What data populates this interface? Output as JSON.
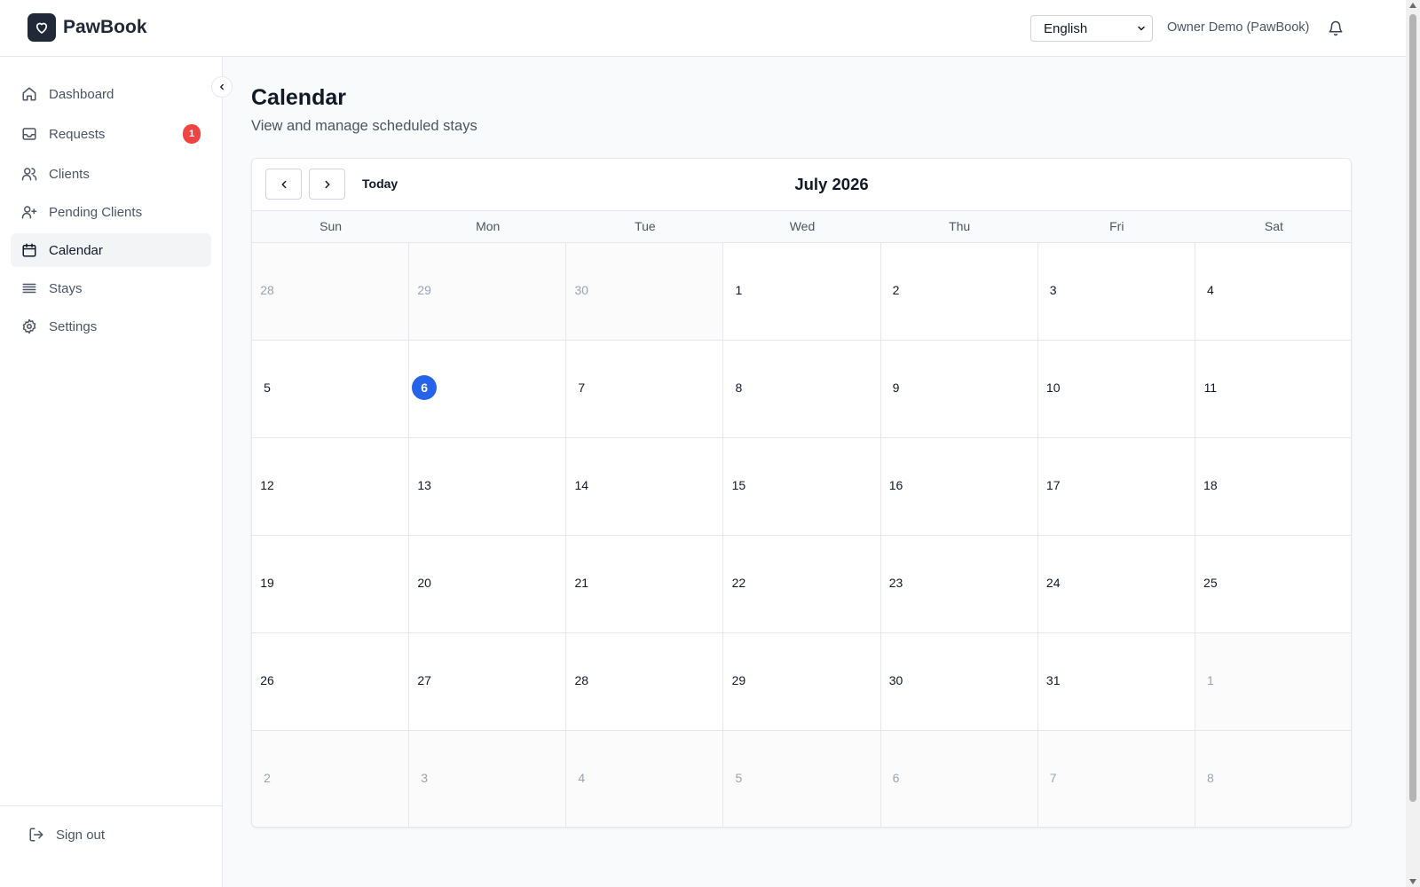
{
  "app": {
    "title": "PawBook"
  },
  "header": {
    "language": "English",
    "language_options": [
      "English"
    ],
    "user_name": "Owner Demo (PawBook)"
  },
  "sidebar": {
    "items": [
      {
        "label": "Dashboard",
        "icon": "home-icon"
      },
      {
        "label": "Requests",
        "icon": "inbox-icon",
        "badge": "1"
      },
      {
        "label": "Clients",
        "icon": "users-icon"
      },
      {
        "label": "Pending Clients",
        "icon": "user-plus-icon"
      },
      {
        "label": "Calendar",
        "icon": "calendar-icon",
        "active": true
      },
      {
        "label": "Stays",
        "icon": "list-icon"
      },
      {
        "label": "Settings",
        "icon": "gear-icon"
      }
    ],
    "signout_label": "Sign out"
  },
  "page": {
    "title": "Calendar",
    "subtitle": "View and manage scheduled stays"
  },
  "calendar": {
    "today_label": "Today",
    "month_label": "July 2026",
    "weekdays": [
      "Sun",
      "Mon",
      "Tue",
      "Wed",
      "Thu",
      "Fri",
      "Sat"
    ],
    "today_day": "6",
    "weeks": [
      [
        {
          "d": "28",
          "out": true
        },
        {
          "d": "29",
          "out": true
        },
        {
          "d": "30",
          "out": true
        },
        {
          "d": "1"
        },
        {
          "d": "2"
        },
        {
          "d": "3"
        },
        {
          "d": "4"
        }
      ],
      [
        {
          "d": "5"
        },
        {
          "d": "6",
          "today": true
        },
        {
          "d": "7"
        },
        {
          "d": "8"
        },
        {
          "d": "9"
        },
        {
          "d": "10"
        },
        {
          "d": "11"
        }
      ],
      [
        {
          "d": "12"
        },
        {
          "d": "13"
        },
        {
          "d": "14"
        },
        {
          "d": "15"
        },
        {
          "d": "16"
        },
        {
          "d": "17"
        },
        {
          "d": "18"
        }
      ],
      [
        {
          "d": "19"
        },
        {
          "d": "20"
        },
        {
          "d": "21"
        },
        {
          "d": "22"
        },
        {
          "d": "23"
        },
        {
          "d": "24"
        },
        {
          "d": "25"
        }
      ],
      [
        {
          "d": "26"
        },
        {
          "d": "27"
        },
        {
          "d": "28"
        },
        {
          "d": "29"
        },
        {
          "d": "30"
        },
        {
          "d": "31"
        },
        {
          "d": "1",
          "out": true
        }
      ],
      [
        {
          "d": "2",
          "out": true
        },
        {
          "d": "3",
          "out": true
        },
        {
          "d": "4",
          "out": true
        },
        {
          "d": "5",
          "out": true
        },
        {
          "d": "6",
          "out": true
        },
        {
          "d": "7",
          "out": true
        },
        {
          "d": "8",
          "out": true
        }
      ]
    ]
  },
  "colors": {
    "accent": "#2563eb",
    "badge": "#ef4444",
    "logo_bg": "#1f2937"
  }
}
